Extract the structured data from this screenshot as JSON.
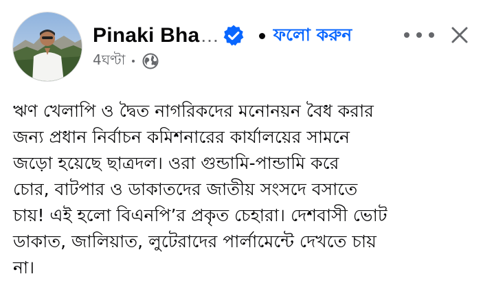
{
  "post": {
    "author": {
      "name": "Pinaki Bha",
      "truncation": "...",
      "avatar_icon": "profile-photo",
      "verified_icon": "verified-badge-icon",
      "verified_color": "#0866ff"
    },
    "follow_label": "ফলো করুন",
    "timestamp": "4ঘণ্টা",
    "audience_icon": "globe-icon",
    "more_icon": "more-options-icon",
    "close_icon": "close-icon",
    "text": "ঋণ খেলাপি ও দ্বৈত নাগরিকদের মনোনয়ন বৈধ করার\nজন্য প্রধান নির্বাচন কমিশনারের কার্যালয়ের সামনে\nজড়ো হয়েছে ছাত্রদল। ওরা গুন্ডামি-পান্ডামি করে\nচোর, বাটপার ও ডাকাতদের জাতীয় সংসদে বসাতে\nচায়! এই হলো বিএনপি’র প্রকৃত চেহারা। দেশবাসী ভোট\nডাকাত, জালিয়াত, লুটেরাদের পার্লামেন্টে দেখতে চায়\nনা।"
  },
  "colors": {
    "link_blue": "#0866ff",
    "secondary_text": "#65676b",
    "primary_text": "#080809",
    "background": "#ffffff"
  }
}
